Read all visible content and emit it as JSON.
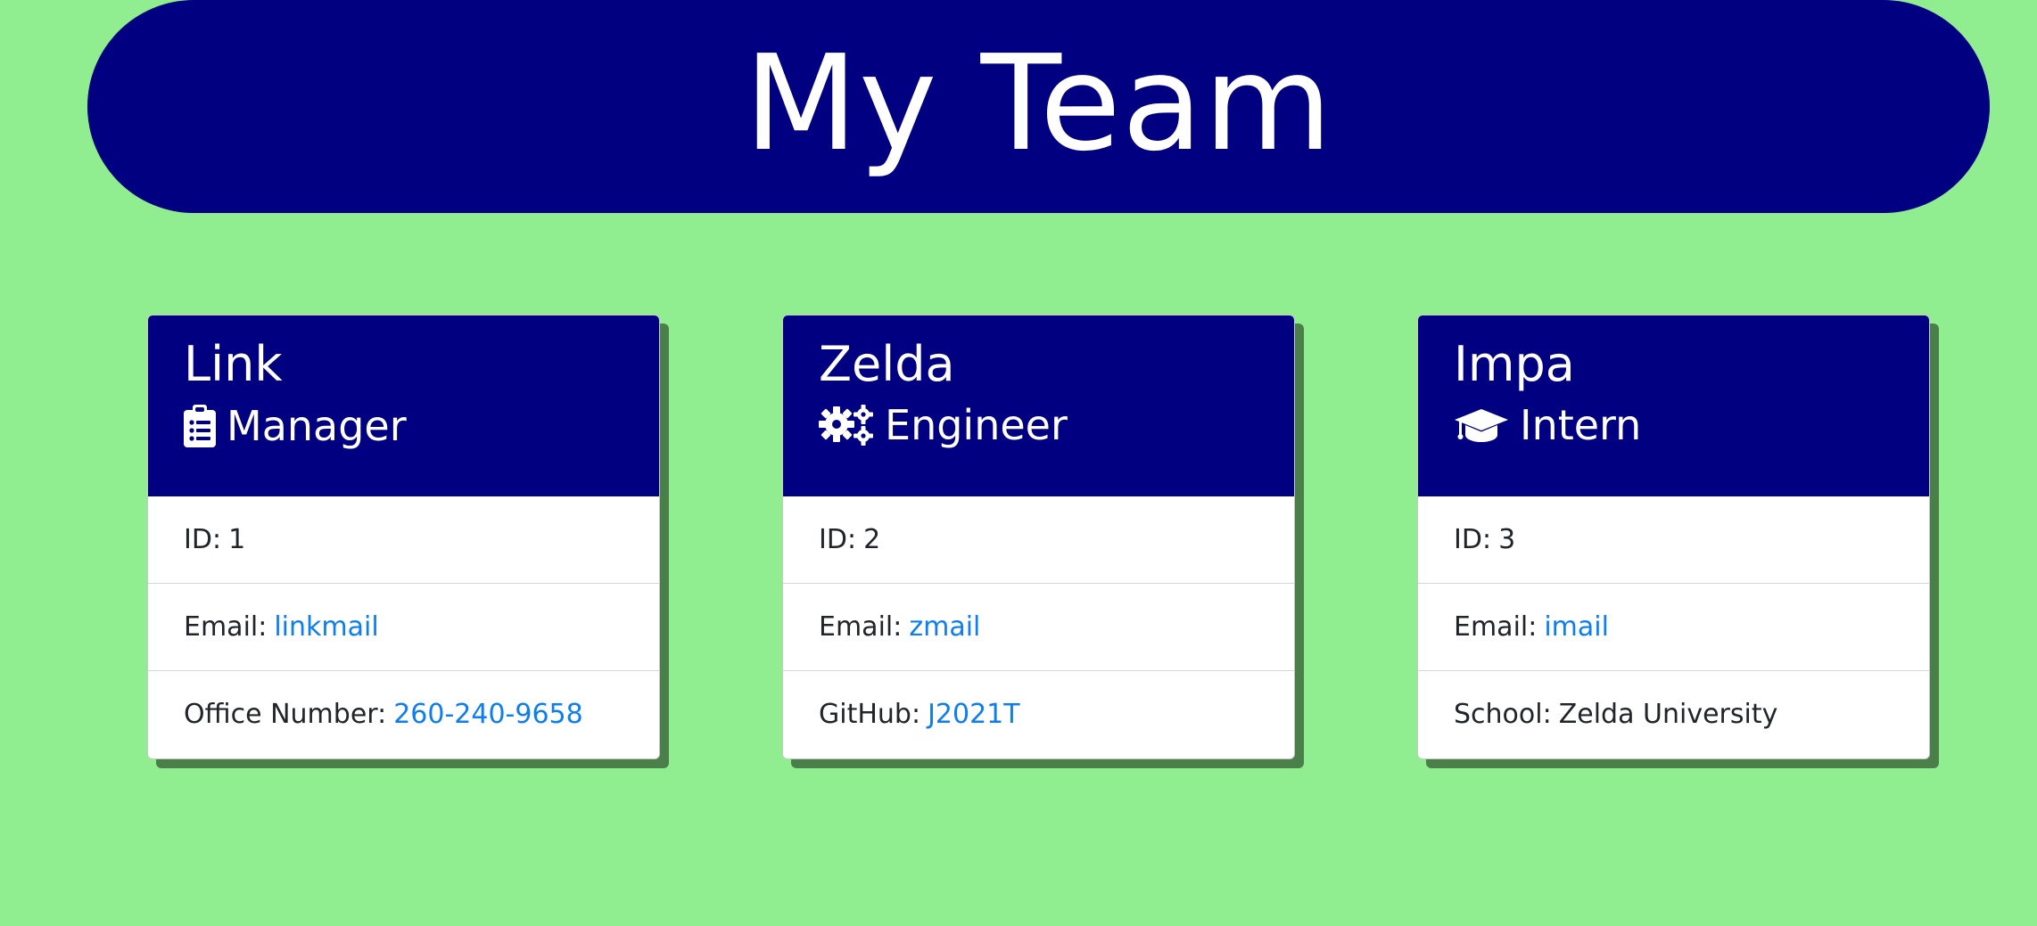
{
  "page": {
    "title": "My Team",
    "background_color": "#90ee90",
    "header_color": "#000080",
    "link_color": "#0d7ef0"
  },
  "cards": [
    {
      "name": "Link",
      "role": "Manager",
      "role_icon": "clipboard-list-icon",
      "id_label": "ID:",
      "id_value": "1",
      "email_label": "Email:",
      "email_value": "linkmail",
      "extra_label": "Office Number:",
      "extra_value": "260-240-9658"
    },
    {
      "name": "Zelda",
      "role": "Engineer",
      "role_icon": "cogs-icon",
      "id_label": "ID:",
      "id_value": "2",
      "email_label": "Email:",
      "email_value": "zmail",
      "extra_label": "GitHub:",
      "extra_value": "J2021T"
    },
    {
      "name": "Impa",
      "role": "Intern",
      "role_icon": "graduation-cap-icon",
      "id_label": "ID:",
      "id_value": "3",
      "email_label": "Email:",
      "email_value": "imail",
      "extra_label": "School:",
      "extra_value": "Zelda University"
    }
  ]
}
